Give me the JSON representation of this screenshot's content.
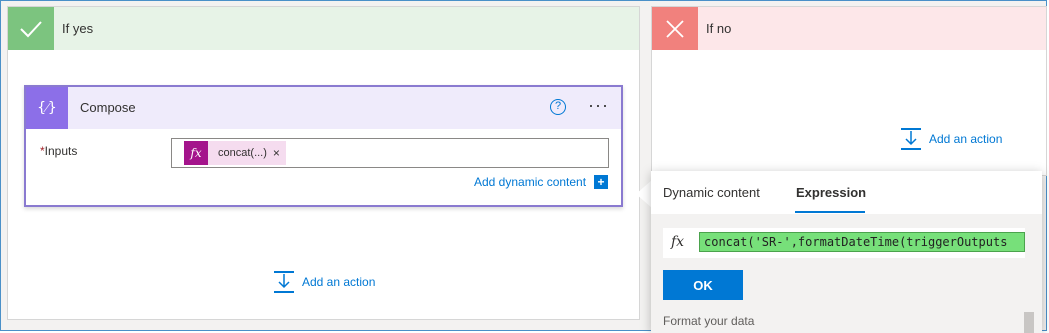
{
  "yes_branch": {
    "title": "If yes",
    "add_action_label": "Add an action"
  },
  "no_branch": {
    "title": "If no",
    "add_action_label": "Add an action"
  },
  "compose": {
    "title": "Compose",
    "help_symbol": "?",
    "more_symbol": "···",
    "inputs_label": "Inputs",
    "required_marker": "*",
    "token": {
      "icon": "fx",
      "text": "concat(...)",
      "remove_symbol": "×"
    },
    "add_dynamic_label": "Add dynamic content",
    "add_dynamic_icon_symbol": "+"
  },
  "popover": {
    "tabs": [
      {
        "label": "Dynamic content",
        "active": false
      },
      {
        "label": "Expression",
        "active": true
      }
    ],
    "expression_icon": "fx",
    "expression_value": "concat('SR-',formatDateTime(triggerOutputs",
    "ok_label": "OK",
    "section_label": "Format your data"
  },
  "colors": {
    "accent": "#0078d4",
    "yes_header": "#e7f3e7",
    "yes_icon": "#7cc47f",
    "no_header": "#fde7e9",
    "no_icon": "#f1817d",
    "compose_icon": "#8c6fe8",
    "token_fx": "#a4148c",
    "expression_highlight": "#77e07a"
  },
  "icons": {
    "yes": "checkmark-icon",
    "no": "x-icon",
    "compose": "compose-braces-icon",
    "add_action": "add-action-icon"
  }
}
